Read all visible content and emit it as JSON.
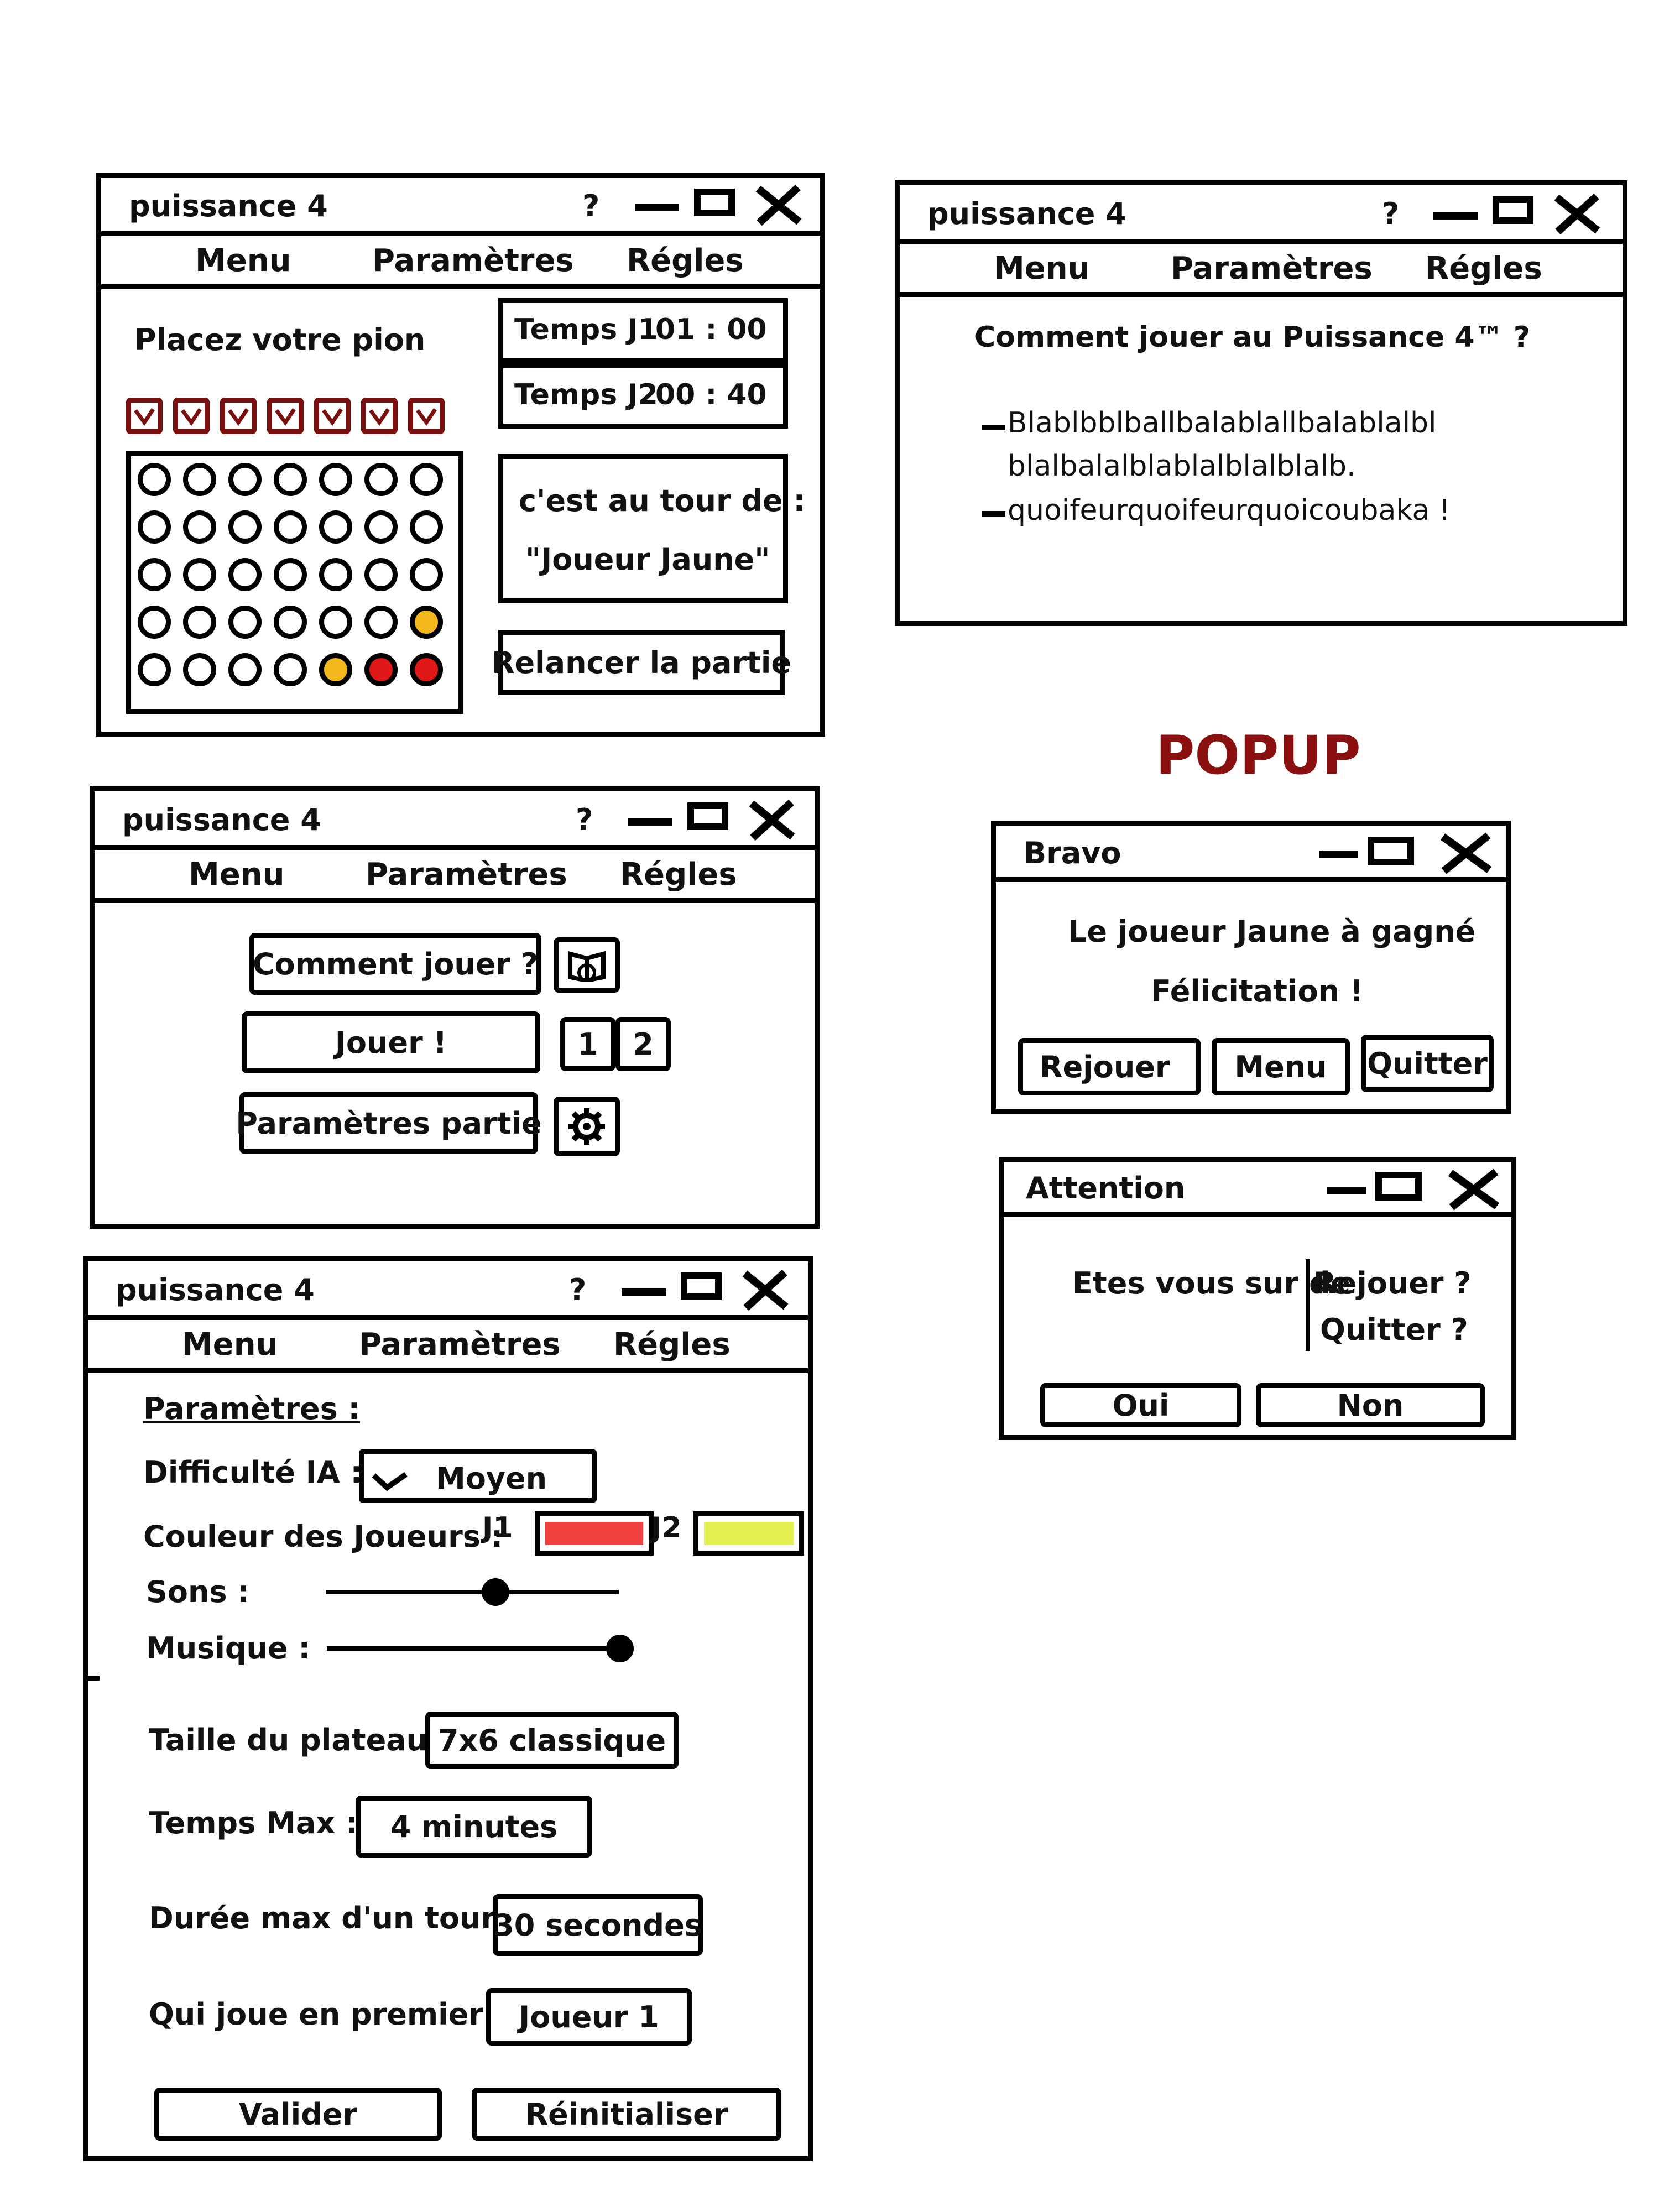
{
  "app": {
    "title": "puissance 4",
    "help_label": "?",
    "menu": [
      "Menu",
      "Paramètres",
      "Régles"
    ]
  },
  "game_screen": {
    "instruction": "Placez votre pion",
    "timer_j1": {
      "label": "Temps J1",
      "value": "01 : 00"
    },
    "timer_j2": {
      "label": "Temps J2",
      "value": "00 : 40"
    },
    "turn_label": "c'est au tour de :",
    "turn_player": "\"Joueur Jaune\"",
    "restart_button": "Relancer la partie",
    "columns": 7,
    "rows": 5,
    "board": [
      [
        "",
        "",
        "",
        "",
        "",
        "",
        ""
      ],
      [
        "",
        "",
        "",
        "",
        "",
        "",
        ""
      ],
      [
        "",
        "",
        "",
        "",
        "",
        "",
        ""
      ],
      [
        "",
        "",
        "",
        "",
        "",
        "",
        "yellow"
      ],
      [
        "",
        "",
        "",
        "",
        "yellow",
        "red",
        "red"
      ]
    ],
    "colors": {
      "red": "#e01818",
      "yellow": "#f2b81e",
      "column_marker": "#7a0f0f"
    }
  },
  "rules_screen": {
    "heading": "Comment jouer au Puissance 4™ ?",
    "bullets": [
      {
        "lines": [
          "Blablbblballbalablallbalablalbl",
          "blalbalalblablalblalblalb."
        ]
      },
      {
        "lines": [
          "quoifeurquoifeurquoicoubaka !"
        ]
      }
    ]
  },
  "menu_screen": {
    "how_to_play": "Comment jouer ?",
    "play": "Jouer !",
    "player_options": [
      "1",
      "2"
    ],
    "game_settings": "Paramètres partie"
  },
  "settings_screen": {
    "heading": "Paramètres :",
    "difficulty_label": "Difficulté IA :",
    "difficulty_value": "Moyen",
    "colors_label": "Couleur des Joueurs :",
    "j1_label": "J1",
    "j2_label": "J2",
    "j1_color": "#f04040",
    "j2_color": "#e4f050",
    "sounds_label": "Sons :",
    "sounds_level": 0.58,
    "music_label": "Musique :",
    "music_level": 1.0,
    "board_size_label": "Taille du plateau :",
    "board_size_value": "7x6 classique",
    "max_time_label": "Temps Max :",
    "max_time_value": "4 minutes",
    "turn_time_label": "Durée max d'un tour :",
    "turn_time_value": "30 secondes",
    "first_player_label": "Qui joue en premier :",
    "first_player_value": "Joueur 1",
    "validate_button": "Valider",
    "reset_button": "Réinitialiser"
  },
  "popup_heading": "POPUP",
  "popup_heading_color": "#8a1010",
  "bravo_popup": {
    "title": "Bravo",
    "message": "Le joueur Jaune à gagné",
    "congrats": "Félicitation !",
    "buttons": [
      "Rejouer",
      "Menu",
      "Quitter"
    ]
  },
  "attention_popup": {
    "title": "Attention",
    "question": "Etes vous sur de",
    "options": [
      "Rejouer ?",
      "Quitter ?"
    ],
    "yes_button": "Oui",
    "no_button": "Non"
  }
}
